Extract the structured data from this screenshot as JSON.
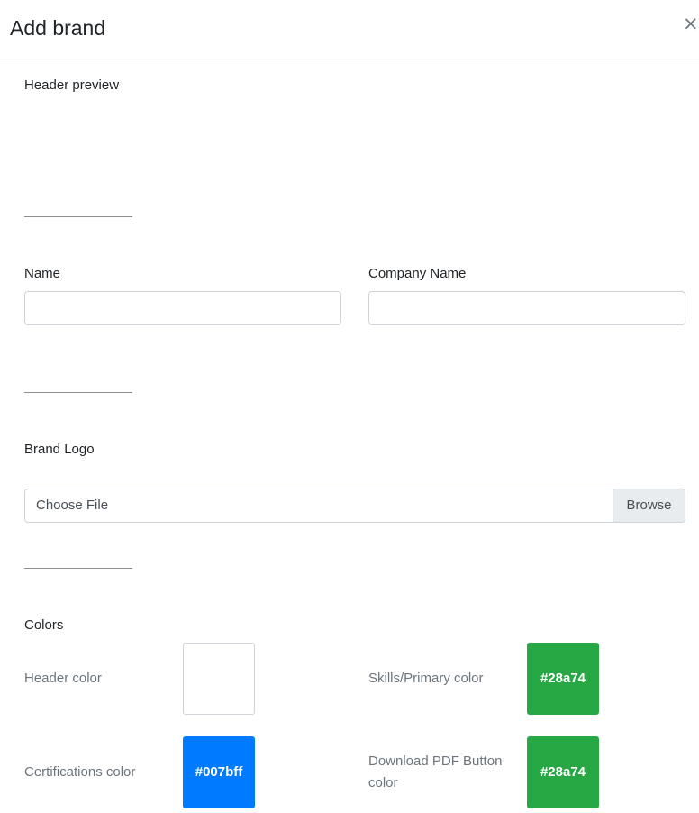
{
  "modal": {
    "title": "Add brand",
    "close_label": "×"
  },
  "sections": {
    "header_preview": "Header preview",
    "brand_logo": "Brand Logo",
    "colors": "Colors"
  },
  "fields": {
    "name_label": "Name",
    "name_value": "",
    "company_label": "Company Name",
    "company_value": ""
  },
  "logo": {
    "file_text": "Choose File",
    "browse_label": "Browse"
  },
  "colors": {
    "header": {
      "label": "Header color",
      "value": "",
      "hex": "#ffffff"
    },
    "skills": {
      "label": "Skills/Primary color",
      "value": "#28a74",
      "hex": "#28a745"
    },
    "certifications": {
      "label": "Certifications color",
      "value": "#007bff",
      "hex": "#007bff"
    },
    "download": {
      "label": "Download PDF Button color",
      "value": "#28a74",
      "hex": "#28a745"
    }
  }
}
